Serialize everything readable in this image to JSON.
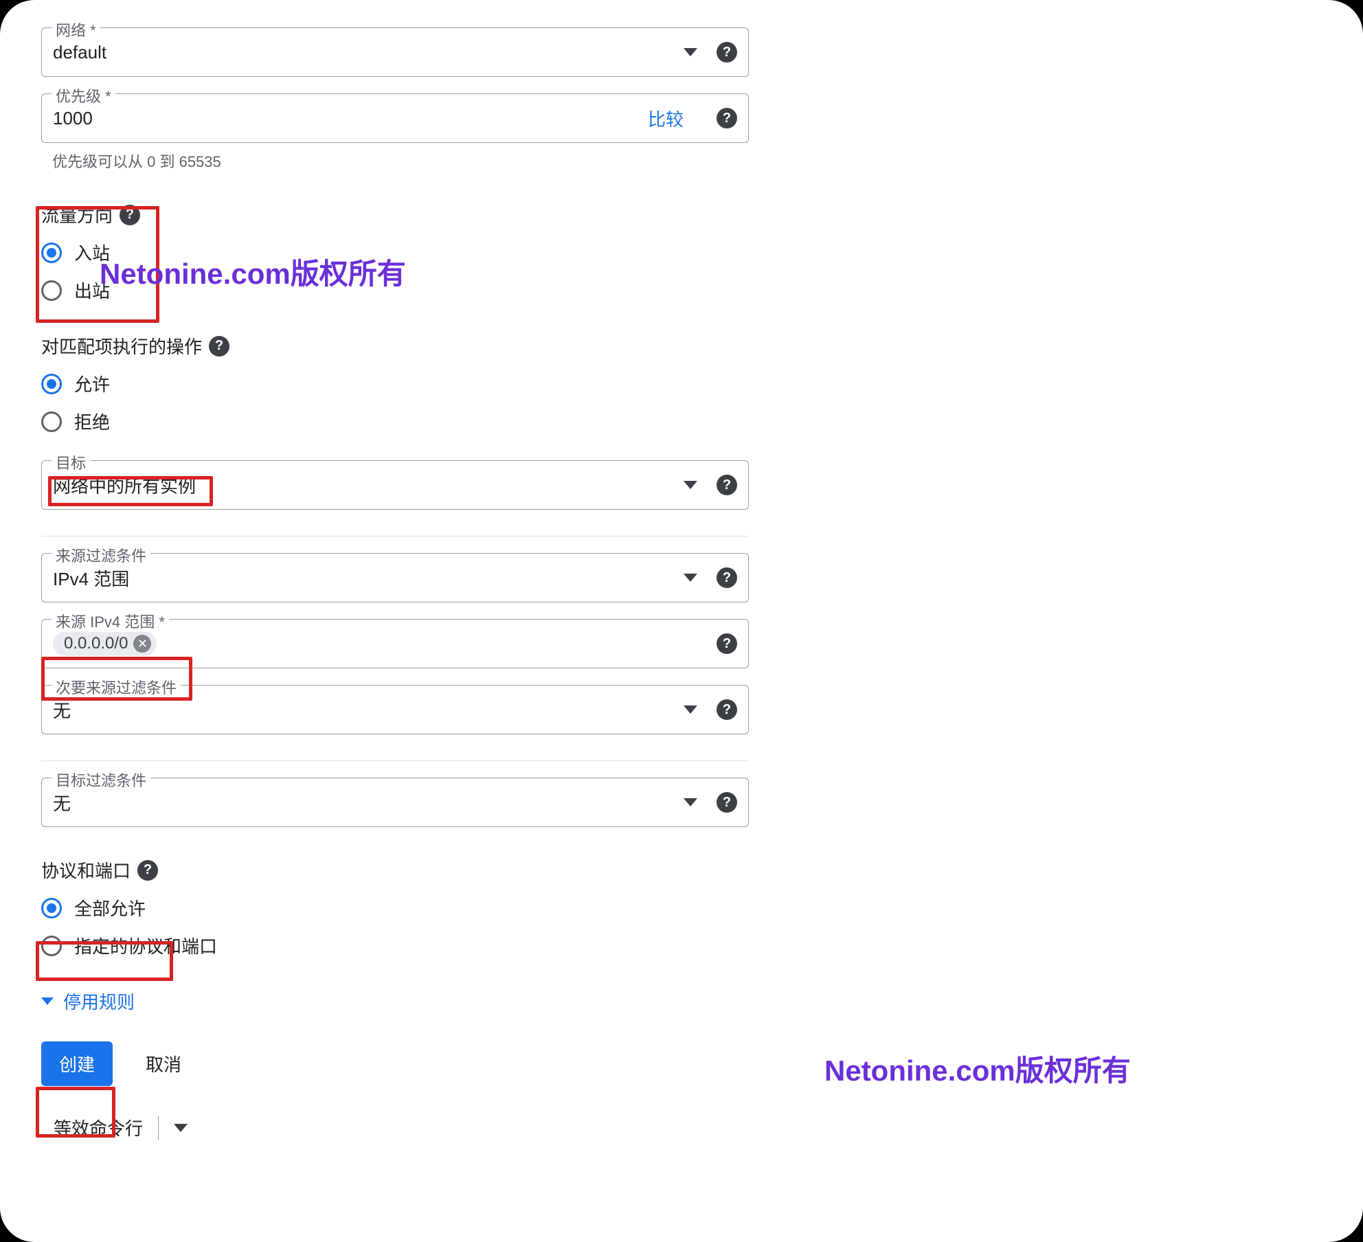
{
  "network": {
    "label": "网络 *",
    "value": "default"
  },
  "priority": {
    "label": "优先级 *",
    "value": "1000",
    "compare": "比较",
    "hint": "优先级可以从 0 到 65535"
  },
  "direction": {
    "title": "流量方向",
    "ingress": "入站",
    "egress": "出站"
  },
  "action": {
    "title": "对匹配项执行的操作",
    "allow": "允许",
    "deny": "拒绝"
  },
  "target": {
    "label": "目标",
    "value": "网络中的所有实例"
  },
  "sourceFilter": {
    "label": "来源过滤条件",
    "value": "IPv4 范围"
  },
  "sourceRange": {
    "label": "来源 IPv4 范围 *",
    "chip": "0.0.0.0/0"
  },
  "secondarySourceFilter": {
    "label": "次要来源过滤条件",
    "value": "无"
  },
  "destFilter": {
    "label": "目标过滤条件",
    "value": "无"
  },
  "protocols": {
    "title": "协议和端口",
    "all": "全部允许",
    "specified": "指定的协议和端口"
  },
  "disableRule": "停用规则",
  "buttons": {
    "create": "创建",
    "cancel": "取消",
    "equiv": "等效命令行"
  },
  "watermark": "Netonine.com版权所有"
}
